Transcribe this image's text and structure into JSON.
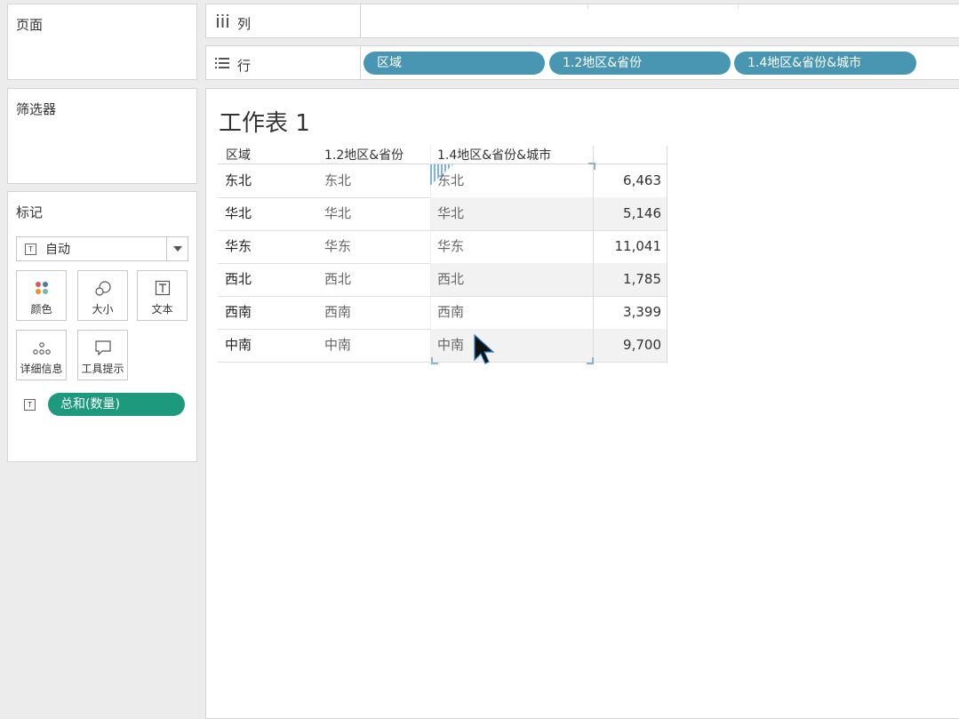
{
  "cards": {
    "pages_title": "页面",
    "filters_title": "筛选器",
    "marks_title": "标记",
    "marks_type": "自动",
    "mark_buttons": [
      {
        "label": "颜色",
        "icon": "color-dots-icon"
      },
      {
        "label": "大小",
        "icon": "size-icon"
      },
      {
        "label": "文本",
        "icon": "text-icon"
      },
      {
        "label": "详细信息",
        "icon": "detail-icon"
      },
      {
        "label": "工具提示",
        "icon": "tooltip-icon"
      }
    ],
    "measure_pill": "总和(数量)"
  },
  "shelves": {
    "columns_label": "列",
    "rows_label": "行",
    "row_pills": [
      "区域",
      "1.2地区&省份",
      "1.4地区&省份&城市"
    ]
  },
  "colors": {
    "row_pill": "#4996b2",
    "measure_pill": "#1d9a7e"
  },
  "view": {
    "sheet_title": "工作表 1",
    "headers": [
      "区域",
      "1.2地区&省份",
      "1.4地区&省份&城市"
    ],
    "rows": [
      {
        "region": "东北",
        "province": "东北",
        "city": "东北",
        "value": "6,463"
      },
      {
        "region": "华北",
        "province": "华北",
        "city": "华北",
        "value": "5,146"
      },
      {
        "region": "华东",
        "province": "华东",
        "city": "华东",
        "value": "11,041"
      },
      {
        "region": "西北",
        "province": "西北",
        "city": "西北",
        "value": "1,785"
      },
      {
        "region": "西南",
        "province": "西南",
        "city": "西南",
        "value": "3,399"
      },
      {
        "region": "中南",
        "province": "中南",
        "city": "中南",
        "value": "9,700"
      }
    ]
  }
}
